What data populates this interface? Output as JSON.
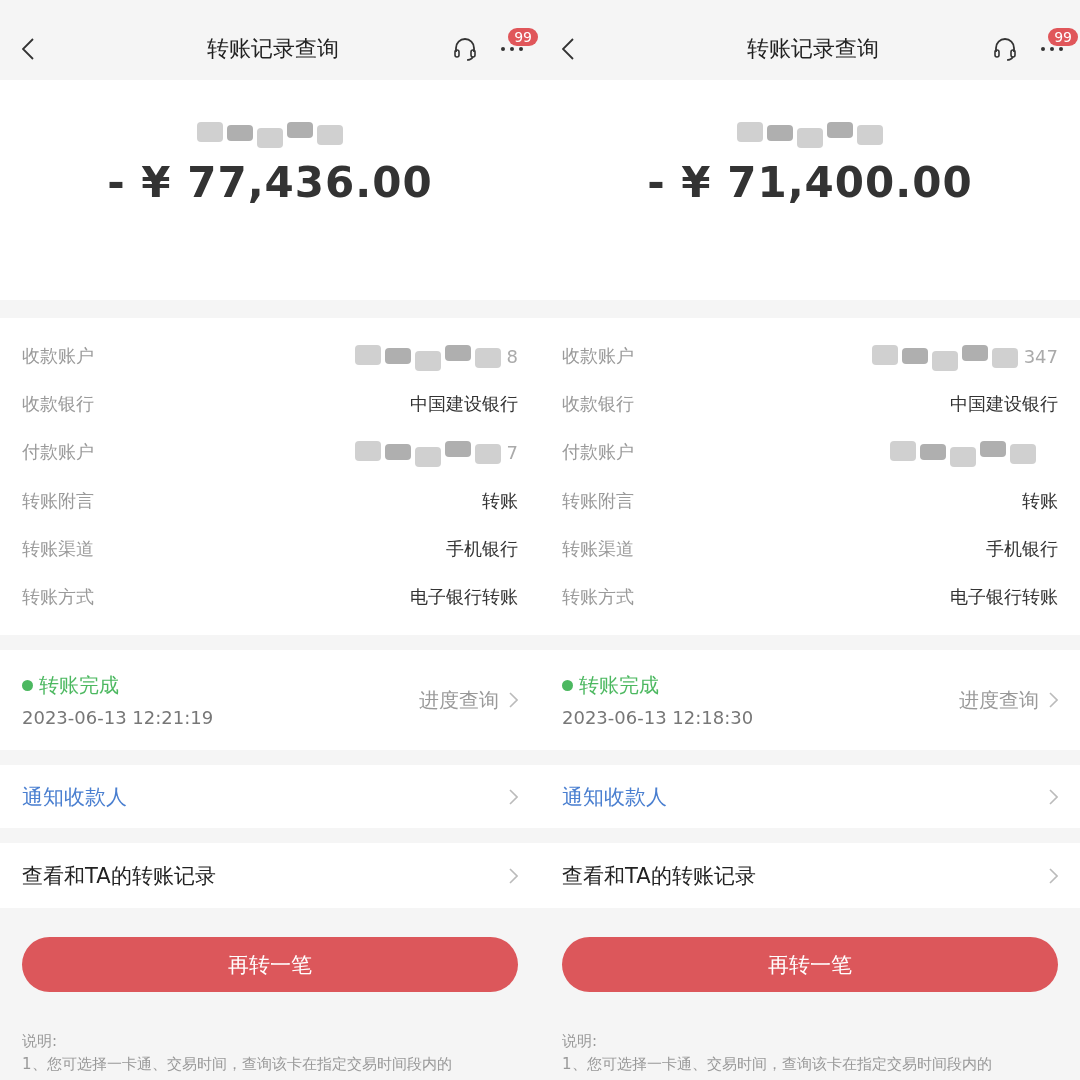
{
  "screens": [
    {
      "nav": {
        "title": "转账记录查询",
        "badge": "99"
      },
      "amount": "- ¥ 77,436.00",
      "details": [
        {
          "label": "收款账户",
          "kind": "masked",
          "value": "8"
        },
        {
          "label": "收款银行",
          "kind": "text",
          "value": "中国建设银行"
        },
        {
          "label": "付款账户",
          "kind": "masked",
          "value": "7"
        },
        {
          "label": "转账附言",
          "kind": "text",
          "value": "转账"
        },
        {
          "label": "转账渠道",
          "kind": "text",
          "value": "手机银行"
        },
        {
          "label": "转账方式",
          "kind": "text",
          "value": "电子银行转账"
        }
      ],
      "status": {
        "label": "转账完成",
        "time": "2023-06-13 12:21:19",
        "link": "进度查询"
      },
      "notify": "通知收款人",
      "history": "查看和TA的转账记录",
      "button": "再转一笔",
      "notes": {
        "heading": "说明:",
        "line": "1、您可选择一卡通、交易时间，查询该卡在指定交易时间段内的"
      }
    },
    {
      "nav": {
        "title": "转账记录查询",
        "badge": "99"
      },
      "amount": "- ¥ 71,400.00",
      "details": [
        {
          "label": "收款账户",
          "kind": "masked",
          "value": "347"
        },
        {
          "label": "收款银行",
          "kind": "text",
          "value": "中国建设银行"
        },
        {
          "label": "付款账户",
          "kind": "masked"
        },
        {
          "label": "转账附言",
          "kind": "text",
          "value": "转账"
        },
        {
          "label": "转账渠道",
          "kind": "text",
          "value": "手机银行"
        },
        {
          "label": "转账方式",
          "kind": "text",
          "value": "电子银行转账"
        }
      ],
      "status": {
        "label": "转账完成",
        "time": "2023-06-13 12:18:30",
        "link": "进度查询"
      },
      "notify": "通知收款人",
      "history": "查看和TA的转账记录",
      "button": "再转一笔",
      "notes": {
        "heading": "说明:",
        "line": "1、您可选择一卡通、交易时间，查询该卡在指定交易时间段内的"
      }
    }
  ]
}
